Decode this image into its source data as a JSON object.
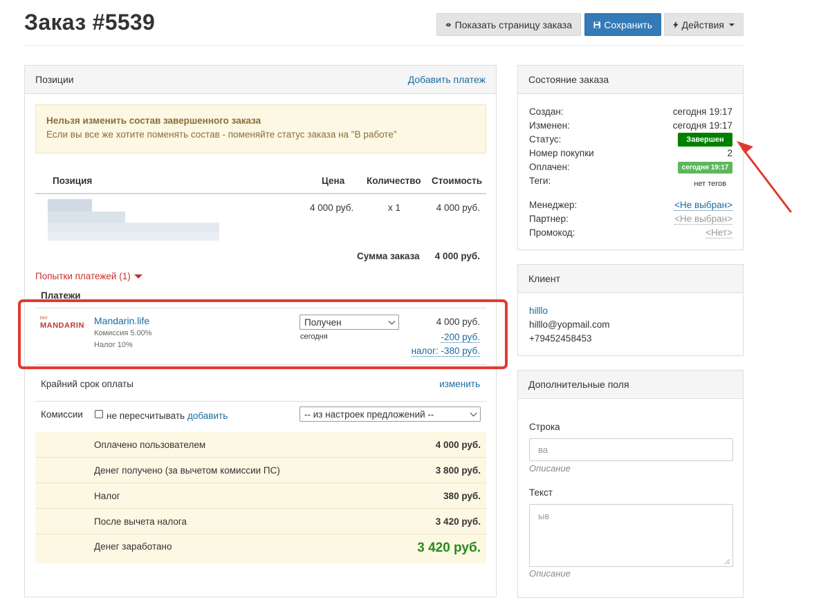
{
  "header": {
    "title": "Заказ #5539",
    "show_page_label": "Показать страницу заказа",
    "save_label": "Сохранить",
    "actions_label": "Действия"
  },
  "positions": {
    "panel_title": "Позиции",
    "add_payment": "Добавить платеж",
    "alert_title": "Нельзя изменить состав завершенного заказа",
    "alert_text": "Если вы все же хотите поменять состав - поменяйте статус заказа на \"В работе\"",
    "columns": {
      "item": "Позиция",
      "price": "Цена",
      "qty": "Количество",
      "cost": "Стоимость"
    },
    "row": {
      "price": "4 000 руб.",
      "qty": "x 1",
      "cost": "4 000 руб."
    },
    "sum_label": "Сумма заказа",
    "sum_value": "4 000 руб.",
    "attempts_label": "Попытки платежей (1)",
    "payments_title": "Платежи",
    "payment": {
      "logo_small": "PAY",
      "logo_big": "MANDARIN",
      "provider": "Mandarin.life",
      "commission": "Комиссия 5.00%",
      "tax": "Налог 10%",
      "status": "Получен",
      "date": "сегодня",
      "amount": "4 000 руб.",
      "fee": "-200 руб.",
      "tax_amount": "налог: -380 руб."
    },
    "deadline_label": "Крайний срок оплаты",
    "deadline_change": "изменить",
    "commissions_label": "Комиссии",
    "no_recalc_label": "не пересчитывать",
    "add_link": "добавить",
    "commission_select": "-- из настроек предложений --",
    "summary": [
      {
        "label": "Оплачено пользователем",
        "value": "4 000 руб."
      },
      {
        "label": "Денег получено (за вычетом комиссии ПС)",
        "value": "3 800 руб."
      },
      {
        "label": "Налог",
        "value": "380 руб."
      },
      {
        "label": "После вычета налога",
        "value": "3 420 руб."
      },
      {
        "label": "Денег заработано",
        "value": "3 420 руб."
      }
    ]
  },
  "status": {
    "panel_title": "Состояние заказа",
    "created_label": "Создан:",
    "created_value": "сегодня 19:17",
    "changed_label": "Изменен:",
    "changed_value": "сегодня 19:17",
    "status_label": "Статус:",
    "status_value": "Завершен",
    "purchase_label": "Номер покупки",
    "purchase_value": "2",
    "paid_label": "Оплачен:",
    "paid_value": "сегодня 19:17",
    "tags_label": "Теги:",
    "tags_value": "нет тегов",
    "manager_label": "Менеджер:",
    "manager_value": "<Не выбран>",
    "partner_label": "Партнер:",
    "partner_value": "<Не выбран>",
    "promo_label": "Промокод:",
    "promo_value": "<Нет>"
  },
  "client": {
    "panel_title": "Клиент",
    "name": "hilllo",
    "email": "hilllo@yopmail.com",
    "phone": "+79452458453"
  },
  "extra": {
    "panel_title": "Дополнительные поля",
    "string_label": "Строка",
    "string_value": "ва",
    "string_help": "Описание",
    "text_label": "Текст",
    "text_value": "ыв",
    "text_help": "Описание"
  },
  "colors": {
    "primary": "#337ab7",
    "link": "#1a6aa0",
    "status_green": "#008000",
    "paid_green": "#5cb85c",
    "earned_green": "#2a8a1e",
    "highlight_red": "#e03a2f",
    "alert_bg": "#fcf8e3"
  }
}
